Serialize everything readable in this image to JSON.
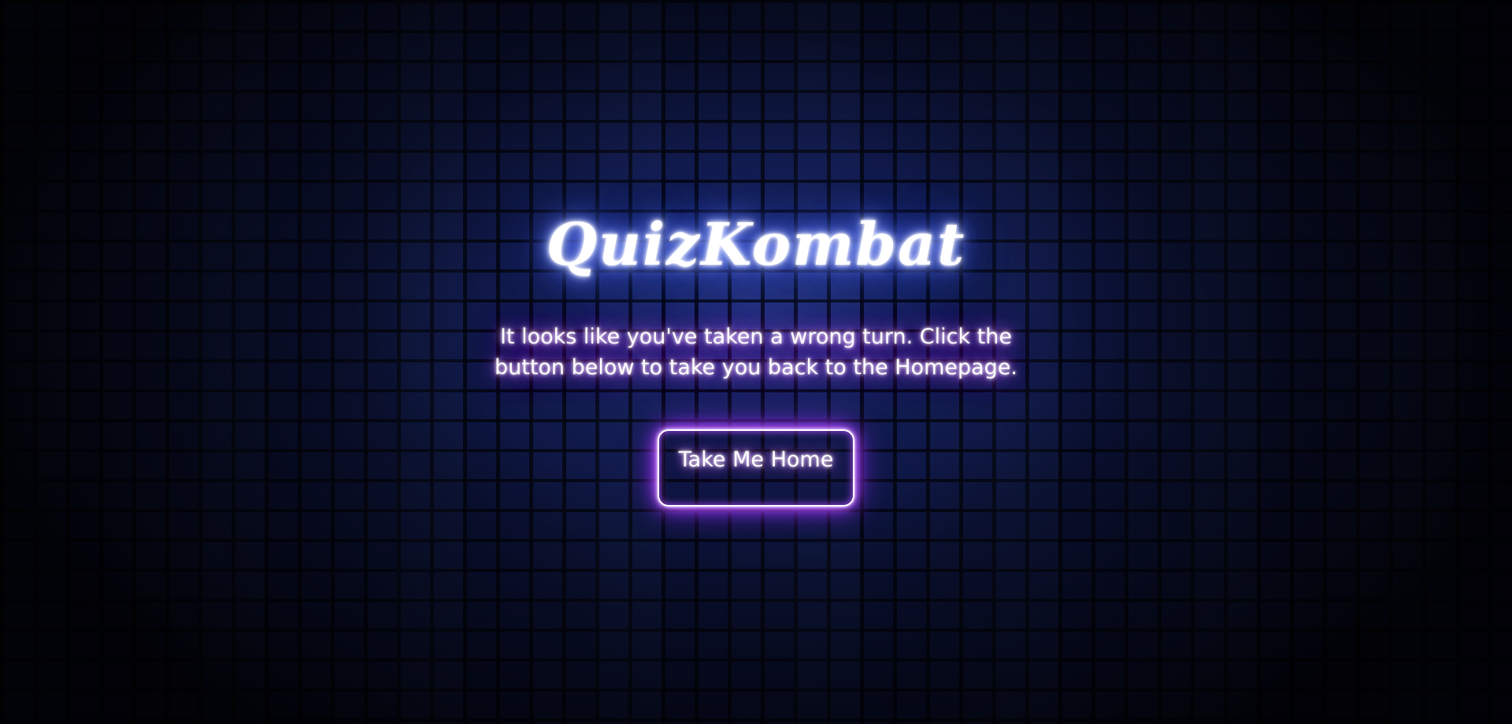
{
  "brand": {
    "title": "QuizKombat"
  },
  "error": {
    "message": "It looks like you've taken a wrong turn. Click the button below to take you back to the Homepage."
  },
  "actions": {
    "home_button_label": "Take Me Home"
  },
  "colors": {
    "background": "#070b24",
    "title_glow": "#4f6bff",
    "message_glow": "#b650ff",
    "button_glow": "#8f23ff",
    "text": "#ffffff"
  }
}
